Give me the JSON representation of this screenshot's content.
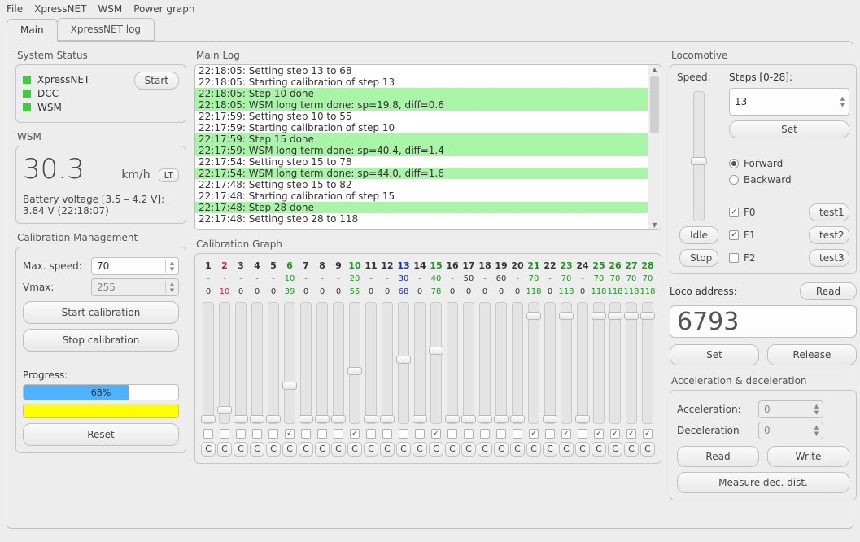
{
  "menubar": [
    "File",
    "XpressNET",
    "WSM",
    "Power graph"
  ],
  "tabs": {
    "main": "Main",
    "xnlog": "XpressNET log"
  },
  "system_status": {
    "title": "System Status",
    "items": [
      "XpressNET",
      "DCC",
      "WSM"
    ],
    "start_btn": "Start"
  },
  "wsm": {
    "title": "WSM",
    "speed": "30.3",
    "unit": "km/h",
    "lt_btn": "LT",
    "batt_label": "Battery voltage [3.5 – 4.2 V]:",
    "batt_value": "3.84 V (22:18:07)"
  },
  "cal_mgmt": {
    "title": "Calibration Management",
    "max_speed_lbl": "Max. speed:",
    "max_speed": "70",
    "vmax_lbl": "Vmax:",
    "vmax": "255",
    "start_btn": "Start calibration",
    "stop_btn": "Stop calibration",
    "progress_lbl": "Progress:",
    "progress_text": "68%",
    "reset_btn": "Reset"
  },
  "main_log": {
    "title": "Main Log",
    "lines": [
      {
        "t": "22:18:05: Setting step 13 to 68",
        "hl": false
      },
      {
        "t": "22:18:05: Starting calibration of step 13",
        "hl": false
      },
      {
        "t": "22:18:05: Step 10 done",
        "hl": true
      },
      {
        "t": "22:18:05: WSM long term done: sp=19.8, diff=0.6",
        "hl": true
      },
      {
        "t": "22:17:59: Setting step 10 to 55",
        "hl": false
      },
      {
        "t": "22:17:59: Starting calibration of step 10",
        "hl": false
      },
      {
        "t": "22:17:59: Step 15 done",
        "hl": true
      },
      {
        "t": "22:17:59: WSM long term done: sp=40.4, diff=1.4",
        "hl": true
      },
      {
        "t": "22:17:54: Setting step 15 to 78",
        "hl": false
      },
      {
        "t": "22:17:54: WSM long term done: sp=44.0, diff=1.6",
        "hl": true
      },
      {
        "t": "22:17:48: Setting step 15 to 82",
        "hl": false
      },
      {
        "t": "22:17:48: Starting calibration of step 15",
        "hl": false
      },
      {
        "t": "22:17:48: Step 28 done",
        "hl": true
      },
      {
        "t": "22:17:48: Setting step 28 to 118",
        "hl": false
      }
    ]
  },
  "cal_graph": {
    "title": "Calibration Graph",
    "c_label": "C",
    "cols": [
      {
        "n": "1",
        "cls": "col-black",
        "v1": "-",
        "v2": "0",
        "pos": 0.0,
        "chk": false
      },
      {
        "n": "2",
        "cls": "col-red",
        "v1": "-",
        "v2": "10",
        "pos": 0.08,
        "chk": false
      },
      {
        "n": "3",
        "cls": "col-black",
        "v1": "-",
        "v2": "0",
        "pos": 0.0,
        "chk": false
      },
      {
        "n": "4",
        "cls": "col-black",
        "v1": "-",
        "v2": "0",
        "pos": 0.0,
        "chk": false
      },
      {
        "n": "5",
        "cls": "col-black",
        "v1": "-",
        "v2": "0",
        "pos": 0.0,
        "chk": false
      },
      {
        "n": "6",
        "cls": "col-green",
        "v1": "10",
        "v2": "39",
        "pos": 0.3,
        "chk": true
      },
      {
        "n": "7",
        "cls": "col-black",
        "v1": "-",
        "v2": "0",
        "pos": 0.0,
        "chk": false
      },
      {
        "n": "8",
        "cls": "col-black",
        "v1": "-",
        "v2": "0",
        "pos": 0.0,
        "chk": false
      },
      {
        "n": "9",
        "cls": "col-black",
        "v1": "-",
        "v2": "0",
        "pos": 0.0,
        "chk": false
      },
      {
        "n": "10",
        "cls": "col-green",
        "v1": "20",
        "v2": "55",
        "pos": 0.43,
        "chk": true
      },
      {
        "n": "11",
        "cls": "col-black",
        "v1": "-",
        "v2": "0",
        "pos": 0.0,
        "chk": false
      },
      {
        "n": "12",
        "cls": "col-black",
        "v1": "-",
        "v2": "0",
        "pos": 0.0,
        "chk": false
      },
      {
        "n": "13",
        "cls": "col-blue",
        "v1": "30",
        "v2": "68",
        "pos": 0.53,
        "chk": false
      },
      {
        "n": "14",
        "cls": "col-black",
        "v1": "-",
        "v2": "0",
        "pos": 0.0,
        "chk": false
      },
      {
        "n": "15",
        "cls": "col-green",
        "v1": "40",
        "v2": "78",
        "pos": 0.61,
        "chk": true
      },
      {
        "n": "16",
        "cls": "col-black",
        "v1": "-",
        "v2": "0",
        "pos": 0.0,
        "chk": false
      },
      {
        "n": "17",
        "cls": "col-black",
        "v1": "50",
        "v2": "0",
        "pos": 0.0,
        "chk": false
      },
      {
        "n": "18",
        "cls": "col-black",
        "v1": "-",
        "v2": "0",
        "pos": 0.0,
        "chk": false
      },
      {
        "n": "19",
        "cls": "col-black",
        "v1": "60",
        "v2": "0",
        "pos": 0.0,
        "chk": false
      },
      {
        "n": "20",
        "cls": "col-black",
        "v1": "-",
        "v2": "0",
        "pos": 0.0,
        "chk": false
      },
      {
        "n": "21",
        "cls": "col-green",
        "v1": "70",
        "v2": "118",
        "pos": 0.92,
        "chk": true
      },
      {
        "n": "22",
        "cls": "col-black",
        "v1": "-",
        "v2": "0",
        "pos": 0.0,
        "chk": false
      },
      {
        "n": "23",
        "cls": "col-green",
        "v1": "70",
        "v2": "118",
        "pos": 0.92,
        "chk": true
      },
      {
        "n": "24",
        "cls": "col-black",
        "v1": "-",
        "v2": "0",
        "pos": 0.0,
        "chk": false
      },
      {
        "n": "25",
        "cls": "col-green",
        "v1": "70",
        "v2": "118",
        "pos": 0.92,
        "chk": true
      },
      {
        "n": "26",
        "cls": "col-green",
        "v1": "70",
        "v2": "118",
        "pos": 0.92,
        "chk": true
      },
      {
        "n": "27",
        "cls": "col-green",
        "v1": "70",
        "v2": "118",
        "pos": 0.92,
        "chk": true
      },
      {
        "n": "28",
        "cls": "col-green",
        "v1": "70",
        "v2": "118",
        "pos": 0.92,
        "chk": true
      }
    ]
  },
  "locomotive": {
    "title": "Locomotive",
    "speed_lbl": "Speed:",
    "steps_lbl": "Steps [0-28]:",
    "steps_val": "13",
    "set_btn": "Set",
    "idle_btn": "Idle",
    "stop_btn": "Stop",
    "forward": "Forward",
    "backward": "Backward",
    "f0": "F0",
    "f1": "F1",
    "f2": "F2",
    "test1": "test1",
    "test2": "test2",
    "test3": "test3"
  },
  "loco_addr": {
    "title": "Loco address:",
    "read_btn": "Read",
    "value": "6793",
    "set_btn": "Set",
    "release_btn": "Release"
  },
  "accel": {
    "title": "Acceleration & deceleration",
    "acc_lbl": "Acceleration:",
    "dec_lbl": "Deceleration",
    "acc_val": "0",
    "dec_val": "0",
    "read_btn": "Read",
    "write_btn": "Write",
    "measure_btn": "Measure dec. dist."
  }
}
